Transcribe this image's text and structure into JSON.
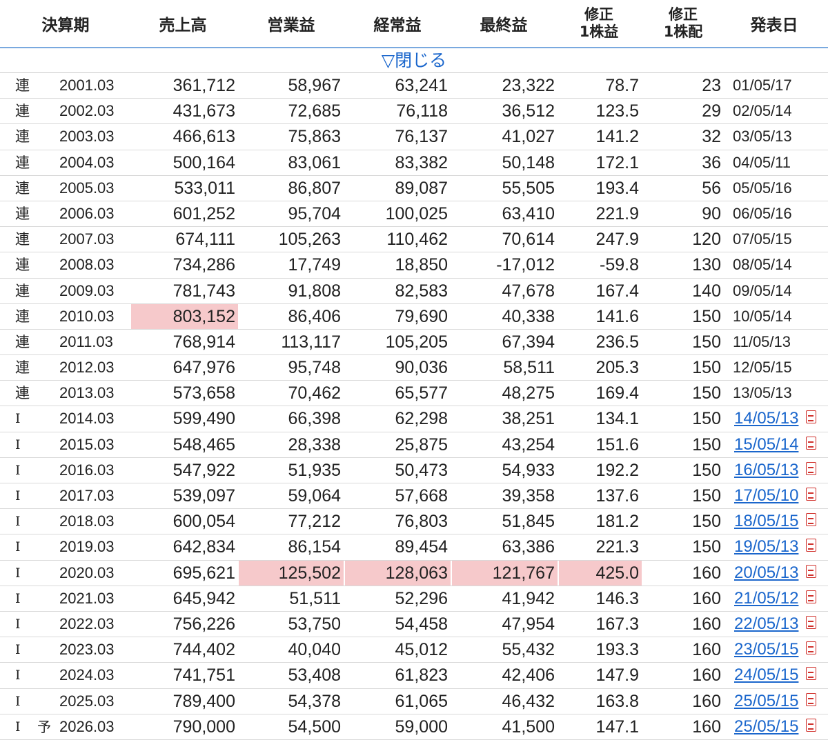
{
  "headers": {
    "period": "決算期",
    "sales": "売上高",
    "operating": "営業益",
    "ordinary": "経常益",
    "net": "最終益",
    "eps_1": "修正",
    "eps_2": "1株益",
    "div_1": "修正",
    "div_2": "1株配",
    "date": "発表日"
  },
  "toggle_label": "▽閉じる",
  "rows": [
    {
      "type": "連",
      "fc": "",
      "period": "2001.03",
      "sales": "361,712",
      "op": "58,967",
      "ord": "63,241",
      "net": "23,322",
      "eps": "78.7",
      "div": "23",
      "date": "01/05/17",
      "link": false
    },
    {
      "type": "連",
      "fc": "",
      "period": "2002.03",
      "sales": "431,673",
      "op": "72,685",
      "ord": "76,118",
      "net": "36,512",
      "eps": "123.5",
      "div": "29",
      "date": "02/05/14",
      "link": false
    },
    {
      "type": "連",
      "fc": "",
      "period": "2003.03",
      "sales": "466,613",
      "op": "75,863",
      "ord": "76,137",
      "net": "41,027",
      "eps": "141.2",
      "div": "32",
      "date": "03/05/13",
      "link": false
    },
    {
      "type": "連",
      "fc": "",
      "period": "2004.03",
      "sales": "500,164",
      "op": "83,061",
      "ord": "83,382",
      "net": "50,148",
      "eps": "172.1",
      "div": "36",
      "date": "04/05/11",
      "link": false
    },
    {
      "type": "連",
      "fc": "",
      "period": "2005.03",
      "sales": "533,011",
      "op": "86,807",
      "ord": "89,087",
      "net": "55,505",
      "eps": "193.4",
      "div": "56",
      "date": "05/05/16",
      "link": false
    },
    {
      "type": "連",
      "fc": "",
      "period": "2006.03",
      "sales": "601,252",
      "op": "95,704",
      "ord": "100,025",
      "net": "63,410",
      "eps": "221.9",
      "div": "90",
      "date": "06/05/16",
      "link": false
    },
    {
      "type": "連",
      "fc": "",
      "period": "2007.03",
      "sales": "674,111",
      "op": "105,263",
      "ord": "110,462",
      "net": "70,614",
      "eps": "247.9",
      "div": "120",
      "date": "07/05/15",
      "link": false
    },
    {
      "type": "連",
      "fc": "",
      "period": "2008.03",
      "sales": "734,286",
      "op": "17,749",
      "ord": "18,850",
      "net": "-17,012",
      "eps": "-59.8",
      "div": "130",
      "date": "08/05/14",
      "link": false
    },
    {
      "type": "連",
      "fc": "",
      "period": "2009.03",
      "sales": "781,743",
      "op": "91,808",
      "ord": "82,583",
      "net": "47,678",
      "eps": "167.4",
      "div": "140",
      "date": "09/05/14",
      "link": false
    },
    {
      "type": "連",
      "fc": "",
      "period": "2010.03",
      "sales": "803,152",
      "op": "86,406",
      "ord": "79,690",
      "net": "40,338",
      "eps": "141.6",
      "div": "150",
      "date": "10/05/14",
      "link": false,
      "hl": [
        "sales"
      ]
    },
    {
      "type": "連",
      "fc": "",
      "period": "2011.03",
      "sales": "768,914",
      "op": "113,117",
      "ord": "105,205",
      "net": "67,394",
      "eps": "236.5",
      "div": "150",
      "date": "11/05/13",
      "link": false
    },
    {
      "type": "連",
      "fc": "",
      "period": "2012.03",
      "sales": "647,976",
      "op": "95,748",
      "ord": "90,036",
      "net": "58,511",
      "eps": "205.3",
      "div": "150",
      "date": "12/05/15",
      "link": false
    },
    {
      "type": "連",
      "fc": "",
      "period": "2013.03",
      "sales": "573,658",
      "op": "70,462",
      "ord": "65,577",
      "net": "48,275",
      "eps": "169.4",
      "div": "150",
      "date": "13/05/13",
      "link": false
    },
    {
      "type": "I",
      "fc": "",
      "period": "2014.03",
      "sales": "599,490",
      "op": "66,398",
      "ord": "62,298",
      "net": "38,251",
      "eps": "134.1",
      "div": "150",
      "date": "14/05/13",
      "link": true
    },
    {
      "type": "I",
      "fc": "",
      "period": "2015.03",
      "sales": "548,465",
      "op": "28,338",
      "ord": "25,875",
      "net": "43,254",
      "eps": "151.6",
      "div": "150",
      "date": "15/05/14",
      "link": true
    },
    {
      "type": "I",
      "fc": "",
      "period": "2016.03",
      "sales": "547,922",
      "op": "51,935",
      "ord": "50,473",
      "net": "54,933",
      "eps": "192.2",
      "div": "150",
      "date": "16/05/13",
      "link": true
    },
    {
      "type": "I",
      "fc": "",
      "period": "2017.03",
      "sales": "539,097",
      "op": "59,064",
      "ord": "57,668",
      "net": "39,358",
      "eps": "137.6",
      "div": "150",
      "date": "17/05/10",
      "link": true
    },
    {
      "type": "I",
      "fc": "",
      "period": "2018.03",
      "sales": "600,054",
      "op": "77,212",
      "ord": "76,803",
      "net": "51,845",
      "eps": "181.2",
      "div": "150",
      "date": "18/05/15",
      "link": true
    },
    {
      "type": "I",
      "fc": "",
      "period": "2019.03",
      "sales": "642,834",
      "op": "86,154",
      "ord": "89,454",
      "net": "63,386",
      "eps": "221.3",
      "div": "150",
      "date": "19/05/13",
      "link": true
    },
    {
      "type": "I",
      "fc": "",
      "period": "2020.03",
      "sales": "695,621",
      "op": "125,502",
      "ord": "128,063",
      "net": "121,767",
      "eps": "425.0",
      "div": "160",
      "date": "20/05/13",
      "link": true,
      "hl": [
        "op",
        "ord",
        "net",
        "eps"
      ]
    },
    {
      "type": "I",
      "fc": "",
      "period": "2021.03",
      "sales": "645,942",
      "op": "51,511",
      "ord": "52,296",
      "net": "41,942",
      "eps": "146.3",
      "div": "160",
      "date": "21/05/12",
      "link": true
    },
    {
      "type": "I",
      "fc": "",
      "period": "2022.03",
      "sales": "756,226",
      "op": "53,750",
      "ord": "54,458",
      "net": "47,954",
      "eps": "167.3",
      "div": "160",
      "date": "22/05/13",
      "link": true
    },
    {
      "type": "I",
      "fc": "",
      "period": "2023.03",
      "sales": "744,402",
      "op": "40,040",
      "ord": "45,012",
      "net": "55,432",
      "eps": "193.3",
      "div": "160",
      "date": "23/05/15",
      "link": true
    },
    {
      "type": "I",
      "fc": "",
      "period": "2024.03",
      "sales": "741,751",
      "op": "53,408",
      "ord": "61,823",
      "net": "42,406",
      "eps": "147.9",
      "div": "160",
      "date": "24/05/15",
      "link": true
    },
    {
      "type": "I",
      "fc": "",
      "period": "2025.03",
      "sales": "789,400",
      "op": "54,378",
      "ord": "61,065",
      "net": "46,432",
      "eps": "163.8",
      "div": "160",
      "date": "25/05/15",
      "link": true
    },
    {
      "type": "I",
      "fc": "予",
      "period": "2026.03",
      "sales": "790,000",
      "op": "54,500",
      "ord": "59,000",
      "net": "41,500",
      "eps": "147.1",
      "div": "160",
      "date": "25/05/15",
      "link": true
    }
  ],
  "colors": {
    "highlight": "#f6c9cb",
    "link": "#1a66cc",
    "header_rule": "#79a9df",
    "pdf_icon": "#d0302b"
  }
}
